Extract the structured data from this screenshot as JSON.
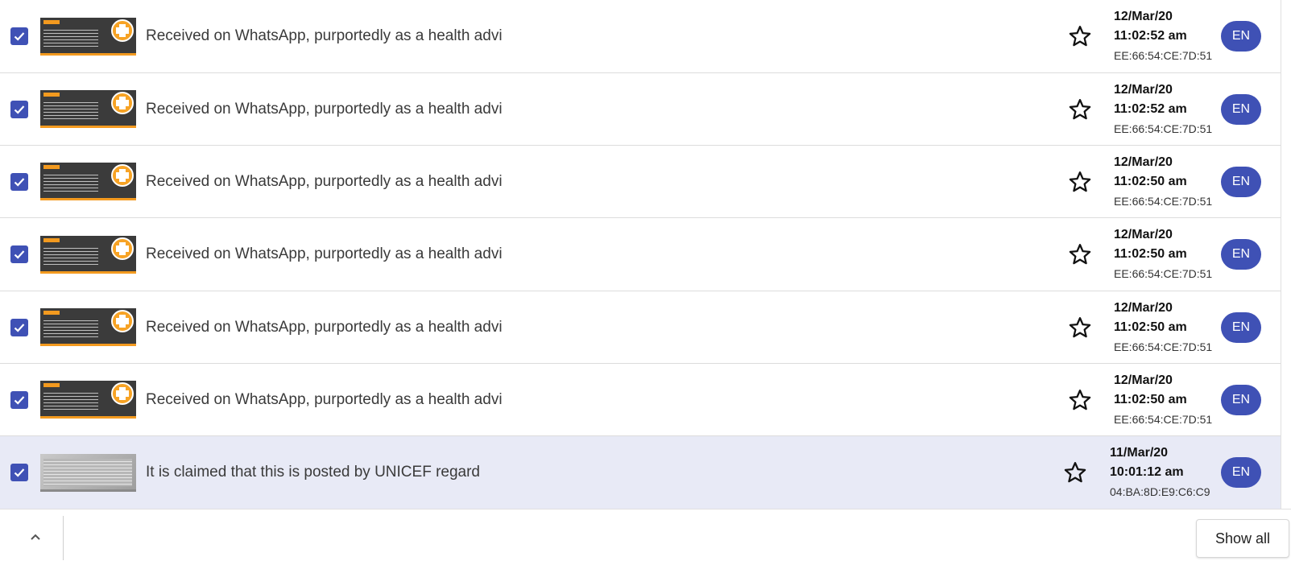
{
  "colors": {
    "accent": "#3f51b5",
    "selected_row_bg": "#e8eaf6",
    "thumbnail_orange": "#f39a1f"
  },
  "items": [
    {
      "title": "Received on WhatsApp, purportedly as a health advi",
      "date": "12/Mar/20",
      "time": "11:02:52 am",
      "mac": "EE:66:54:CE:7D:51",
      "lang": "EN",
      "checked": true,
      "selected": false,
      "thumbnail": "unicef-card"
    },
    {
      "title": "Received on WhatsApp, purportedly as a health advi",
      "date": "12/Mar/20",
      "time": "11:02:52 am",
      "mac": "EE:66:54:CE:7D:51",
      "lang": "EN",
      "checked": true,
      "selected": false,
      "thumbnail": "unicef-card"
    },
    {
      "title": "Received on WhatsApp, purportedly as a health advi",
      "date": "12/Mar/20",
      "time": "11:02:50 am",
      "mac": "EE:66:54:CE:7D:51",
      "lang": "EN",
      "checked": true,
      "selected": false,
      "thumbnail": "unicef-card"
    },
    {
      "title": "Received on WhatsApp, purportedly as a health advi",
      "date": "12/Mar/20",
      "time": "11:02:50 am",
      "mac": "EE:66:54:CE:7D:51",
      "lang": "EN",
      "checked": true,
      "selected": false,
      "thumbnail": "unicef-card"
    },
    {
      "title": "Received on WhatsApp, purportedly as a health advi",
      "date": "12/Mar/20",
      "time": "11:02:50 am",
      "mac": "EE:66:54:CE:7D:51",
      "lang": "EN",
      "checked": true,
      "selected": false,
      "thumbnail": "unicef-card"
    },
    {
      "title": "Received on WhatsApp, purportedly as a health advi",
      "date": "12/Mar/20",
      "time": "11:02:50 am",
      "mac": "EE:66:54:CE:7D:51",
      "lang": "EN",
      "checked": true,
      "selected": false,
      "thumbnail": "unicef-card"
    },
    {
      "title": "It is claimed that this is posted by UNICEF regard",
      "date": "11/Mar/20",
      "time": "10:01:12 am",
      "mac": "04:BA:8D:E9:C6:C9",
      "lang": "EN",
      "checked": true,
      "selected": true,
      "thumbnail": "document-photo"
    }
  ],
  "footer": {
    "collapse_icon": "chevron-up-icon",
    "show_all_label": "Show all"
  }
}
